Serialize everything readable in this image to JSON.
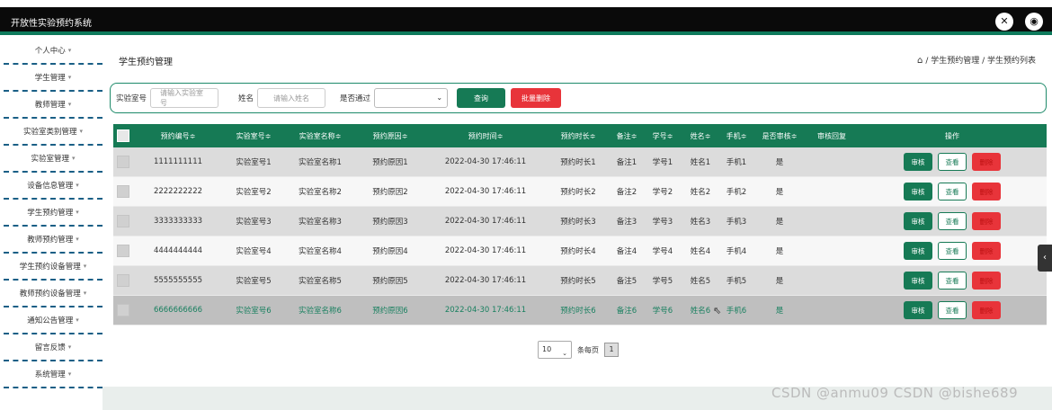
{
  "app": {
    "title": "开放性实验预约系统"
  },
  "header_icons": [
    "fullscreen-icon",
    "user-icon"
  ],
  "sidebar": {
    "items": [
      {
        "label": "个人中心"
      },
      {
        "label": "学生管理"
      },
      {
        "label": "教师管理"
      },
      {
        "label": "实验室类别管理"
      },
      {
        "label": "实验室管理"
      },
      {
        "label": "设备信息管理"
      },
      {
        "label": "学生预约管理"
      },
      {
        "label": "教师预约管理"
      },
      {
        "label": "学生预约设备管理"
      },
      {
        "label": "教师预约设备管理"
      },
      {
        "label": "通知公告管理"
      },
      {
        "label": "留言反馈"
      },
      {
        "label": "系统管理"
      }
    ],
    "caret": "▾"
  },
  "page": {
    "title": "学生预约管理",
    "breadcrumb": "/ 学生预约管理 / 学生预约列表"
  },
  "search": {
    "room_label": "实验室号",
    "room_placeholder": "请输入实验室号",
    "name_label": "姓名",
    "name_placeholder": "请输入姓名",
    "pass_label": "是否通过",
    "pass_value": "",
    "query_button": "查询",
    "batch_delete_button": "批量删除"
  },
  "table": {
    "headers": {
      "id": "预约编号≑",
      "room": "实验室号≑",
      "room_name": "实验室名称≑",
      "reason": "预约原因≑",
      "time": "预约时间≑",
      "duration": "预约时长≑",
      "note": "备注≑",
      "student_id": "学号≑",
      "student_name": "姓名≑",
      "phone": "手机≑",
      "audit": "是否审核≑",
      "reply": "审核回复",
      "ops": "操作"
    },
    "rows": [
      {
        "id": "1111111111",
        "room": "实验室号1",
        "room_name": "实验室名称1",
        "reason": "预约原因1",
        "time": "2022-04-30 17:46:11",
        "duration": "预约时长1",
        "note": "备注1",
        "student_id": "学号1",
        "student_name": "姓名1",
        "phone": "手机1",
        "audit": "是",
        "reply": ""
      },
      {
        "id": "2222222222",
        "room": "实验室号2",
        "room_name": "实验室名称2",
        "reason": "预约原因2",
        "time": "2022-04-30 17:46:11",
        "duration": "预约时长2",
        "note": "备注2",
        "student_id": "学号2",
        "student_name": "姓名2",
        "phone": "手机2",
        "audit": "是",
        "reply": ""
      },
      {
        "id": "3333333333",
        "room": "实验室号3",
        "room_name": "实验室名称3",
        "reason": "预约原因3",
        "time": "2022-04-30 17:46:11",
        "duration": "预约时长3",
        "note": "备注3",
        "student_id": "学号3",
        "student_name": "姓名3",
        "phone": "手机3",
        "audit": "是",
        "reply": ""
      },
      {
        "id": "4444444444",
        "room": "实验室号4",
        "room_name": "实验室名称4",
        "reason": "预约原因4",
        "time": "2022-04-30 17:46:11",
        "duration": "预约时长4",
        "note": "备注4",
        "student_id": "学号4",
        "student_name": "姓名4",
        "phone": "手机4",
        "audit": "是",
        "reply": ""
      },
      {
        "id": "5555555555",
        "room": "实验室号5",
        "room_name": "实验室名称5",
        "reason": "预约原因5",
        "time": "2022-04-30 17:46:11",
        "duration": "预约时长5",
        "note": "备注5",
        "student_id": "学号5",
        "student_name": "姓名5",
        "phone": "手机5",
        "audit": "是",
        "reply": ""
      },
      {
        "id": "6666666666",
        "room": "实验室号6",
        "room_name": "实验室名称6",
        "reason": "预约原因6",
        "time": "2022-04-30 17:46:11",
        "duration": "预约时长6",
        "note": "备注6",
        "student_id": "学号6",
        "student_name": "姓名6",
        "phone": "手机6",
        "audit": "是",
        "reply": ""
      }
    ],
    "actions": {
      "audit": "审核",
      "view": "查看",
      "delete": "删除"
    }
  },
  "pagination": {
    "page_size": "10",
    "per_page_label": "条每页",
    "current_page": "1"
  },
  "watermark": "CSDN @anmu09 CSDN @bishe689",
  "colors": {
    "primary": "#167a55",
    "danger": "#e8343a",
    "topbar": "#0a0a0a"
  }
}
